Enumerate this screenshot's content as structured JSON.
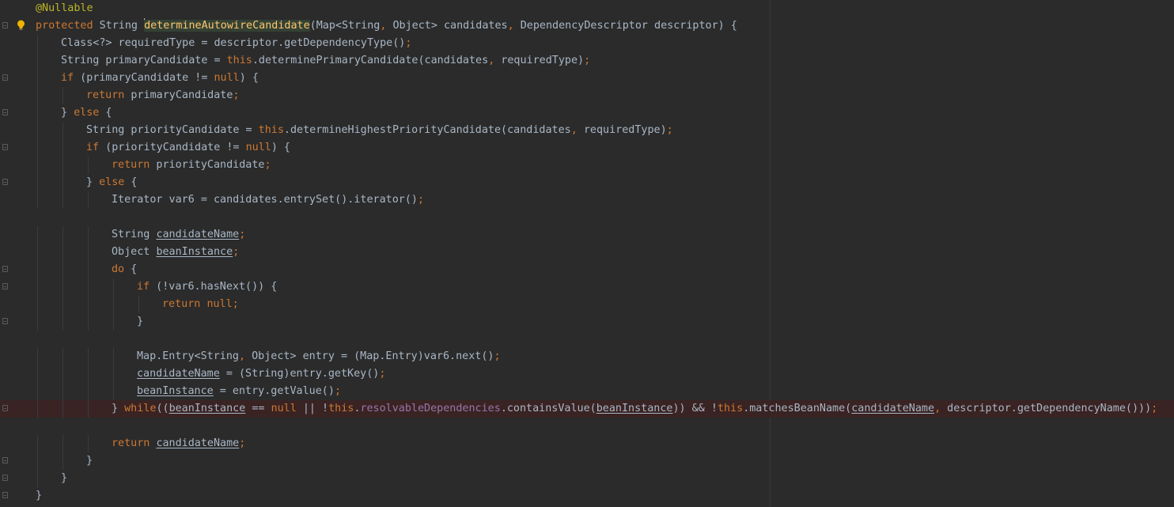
{
  "editor": {
    "language": "Java",
    "colors": {
      "background": "#2b2b2b",
      "text": "#a9b7c6",
      "keyword": "#cc7832",
      "annotation": "#bbb529",
      "method_declaration": "#ffc66d",
      "field": "#9876aa",
      "breakpoint_line_background": "#3a2323",
      "intention_bulb": "#f0b400"
    },
    "gutter_icons": [
      "fold-marker-icon",
      "lightbulb-icon"
    ],
    "lines": [
      {
        "indent": 0,
        "tokens": [
          {
            "t": "@Nullable",
            "c": "an"
          }
        ]
      },
      {
        "indent": 0,
        "fold": true,
        "bulb": true,
        "tokens": [
          {
            "t": "protected",
            "c": "kw"
          },
          {
            "t": " String "
          },
          {
            "t": "determineAutowireCandidate",
            "c": "fn"
          },
          {
            "t": "(Map<String"
          },
          {
            "t": ",",
            "c": "kw"
          },
          {
            "t": " Object> candidates"
          },
          {
            "t": ",",
            "c": "kw"
          },
          {
            "t": " DependencyDescriptor descriptor) {"
          }
        ]
      },
      {
        "indent": 1,
        "tokens": [
          {
            "t": "Class<?> requiredType = descriptor.getDependencyType()"
          },
          {
            "t": ";",
            "c": "kw"
          }
        ]
      },
      {
        "indent": 1,
        "tokens": [
          {
            "t": "String primaryCandidate = "
          },
          {
            "t": "this",
            "c": "kw"
          },
          {
            "t": ".determinePrimaryCandidate(candidates"
          },
          {
            "t": ",",
            "c": "kw"
          },
          {
            "t": " requiredType)"
          },
          {
            "t": ";",
            "c": "kw"
          }
        ]
      },
      {
        "indent": 1,
        "fold": true,
        "tokens": [
          {
            "t": "if",
            "c": "kw"
          },
          {
            "t": " (primaryCandidate != "
          },
          {
            "t": "null",
            "c": "kw"
          },
          {
            "t": ") {"
          }
        ]
      },
      {
        "indent": 2,
        "tokens": [
          {
            "t": "return",
            "c": "kw"
          },
          {
            "t": " primaryCandidate"
          },
          {
            "t": ";",
            "c": "kw"
          }
        ]
      },
      {
        "indent": 1,
        "fold": true,
        "tokens": [
          {
            "t": "} "
          },
          {
            "t": "else",
            "c": "kw"
          },
          {
            "t": " {"
          }
        ]
      },
      {
        "indent": 2,
        "tokens": [
          {
            "t": "String priorityCandidate = "
          },
          {
            "t": "this",
            "c": "kw"
          },
          {
            "t": ".determineHighestPriorityCandidate(candidates"
          },
          {
            "t": ",",
            "c": "kw"
          },
          {
            "t": " requiredType)"
          },
          {
            "t": ";",
            "c": "kw"
          }
        ]
      },
      {
        "indent": 2,
        "fold": true,
        "tokens": [
          {
            "t": "if",
            "c": "kw"
          },
          {
            "t": " (priorityCandidate != "
          },
          {
            "t": "null",
            "c": "kw"
          },
          {
            "t": ") {"
          }
        ]
      },
      {
        "indent": 3,
        "tokens": [
          {
            "t": "return",
            "c": "kw"
          },
          {
            "t": " priorityCandidate"
          },
          {
            "t": ";",
            "c": "kw"
          }
        ]
      },
      {
        "indent": 2,
        "fold": true,
        "tokens": [
          {
            "t": "} "
          },
          {
            "t": "else",
            "c": "kw"
          },
          {
            "t": " {"
          }
        ]
      },
      {
        "indent": 3,
        "tokens": [
          {
            "t": "Iterator var6 = candidates.entrySet().iterator()"
          },
          {
            "t": ";",
            "c": "kw"
          }
        ]
      },
      {
        "indent": 0,
        "tokens": []
      },
      {
        "indent": 3,
        "tokens": [
          {
            "t": "String "
          },
          {
            "t": "candidateName",
            "c": "ul"
          },
          {
            "t": ";",
            "c": "kw"
          }
        ]
      },
      {
        "indent": 3,
        "tokens": [
          {
            "t": "Object "
          },
          {
            "t": "beanInstance",
            "c": "ul"
          },
          {
            "t": ";",
            "c": "kw"
          }
        ]
      },
      {
        "indent": 3,
        "fold": true,
        "tokens": [
          {
            "t": "do",
            "c": "kw"
          },
          {
            "t": " {"
          }
        ]
      },
      {
        "indent": 4,
        "fold": true,
        "tokens": [
          {
            "t": "if",
            "c": "kw"
          },
          {
            "t": " (!var6.hasNext()) {"
          }
        ]
      },
      {
        "indent": 5,
        "tokens": [
          {
            "t": "return",
            "c": "kw"
          },
          {
            "t": " "
          },
          {
            "t": "null",
            "c": "kw"
          },
          {
            "t": ";",
            "c": "kw"
          }
        ]
      },
      {
        "indent": 4,
        "fold": true,
        "tokens": [
          {
            "t": "}"
          }
        ]
      },
      {
        "indent": 0,
        "tokens": []
      },
      {
        "indent": 4,
        "tokens": [
          {
            "t": "Map.Entry<String"
          },
          {
            "t": ",",
            "c": "kw"
          },
          {
            "t": " Object> entry = (Map.Entry)var6.next()"
          },
          {
            "t": ";",
            "c": "kw"
          }
        ]
      },
      {
        "indent": 4,
        "tokens": [
          {
            "t": "candidateName",
            "c": "ul"
          },
          {
            "t": " = (String)entry.getKey()"
          },
          {
            "t": ";",
            "c": "kw"
          }
        ]
      },
      {
        "indent": 4,
        "tokens": [
          {
            "t": "beanInstance",
            "c": "ul"
          },
          {
            "t": " = entry.getValue()"
          },
          {
            "t": ";",
            "c": "kw"
          }
        ]
      },
      {
        "indent": 3,
        "fold": true,
        "breakpoint": true,
        "tokens": [
          {
            "t": "} "
          },
          {
            "t": "while",
            "c": "kw"
          },
          {
            "t": "(("
          },
          {
            "t": "beanInstance",
            "c": "ul"
          },
          {
            "t": " == "
          },
          {
            "t": "null",
            "c": "kw"
          },
          {
            "t": " || !"
          },
          {
            "t": "this",
            "c": "kw"
          },
          {
            "t": "."
          },
          {
            "t": "resolvableDependencies",
            "c": "fd"
          },
          {
            "t": ".containsValue("
          },
          {
            "t": "beanInstance",
            "c": "ul"
          },
          {
            "t": ")) && !"
          },
          {
            "t": "this",
            "c": "kw"
          },
          {
            "t": ".matchesBeanName("
          },
          {
            "t": "candidateName",
            "c": "ul"
          },
          {
            "t": ",",
            "c": "kw"
          },
          {
            "t": " descriptor.getDependencyName()))"
          },
          {
            "t": ";",
            "c": "kw"
          }
        ]
      },
      {
        "indent": 0,
        "tokens": []
      },
      {
        "indent": 3,
        "tokens": [
          {
            "t": "return",
            "c": "kw"
          },
          {
            "t": " "
          },
          {
            "t": "candidateName",
            "c": "ul"
          },
          {
            "t": ";",
            "c": "kw"
          }
        ]
      },
      {
        "indent": 2,
        "fold": true,
        "tokens": [
          {
            "t": "}"
          }
        ]
      },
      {
        "indent": 1,
        "fold": true,
        "tokens": [
          {
            "t": "}"
          }
        ]
      },
      {
        "indent": 0,
        "fold": true,
        "tokens": [
          {
            "t": "}"
          }
        ]
      }
    ]
  }
}
